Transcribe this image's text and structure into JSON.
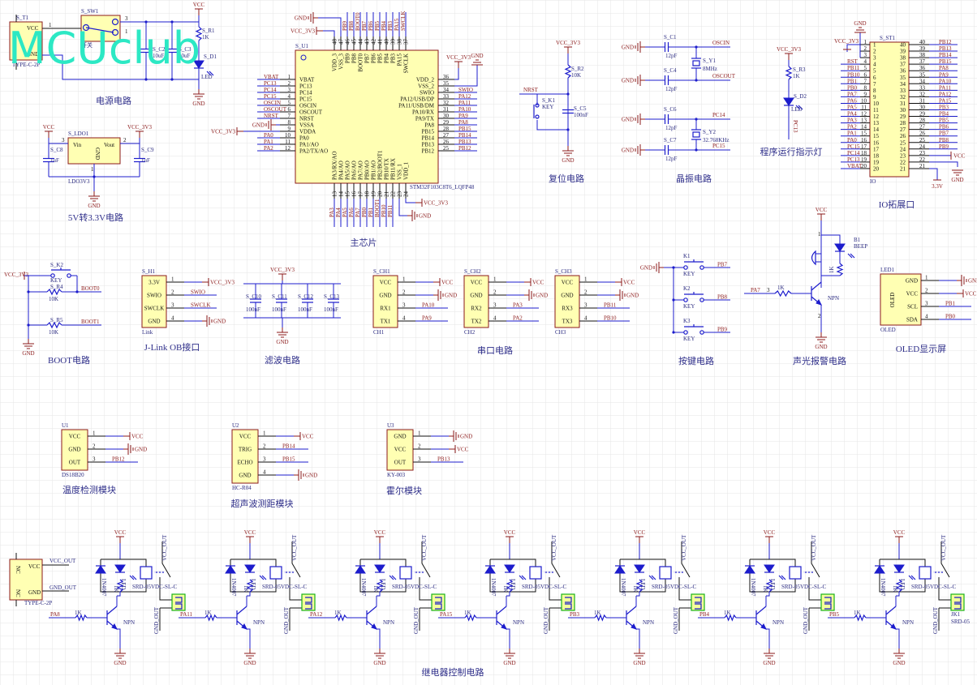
{
  "watermark": "MCUclub",
  "colors": {
    "wire": "#1c1ccc",
    "net_label": "#8b1a1a",
    "component_fill": "#ffffb3",
    "component_border": "#8b1a1a",
    "title": "#2f2f8a",
    "watermark": "#2ce8c4",
    "relay_connector": "#19b019"
  },
  "nets": {
    "vcc": "VCC",
    "gnd": "GND",
    "v33": "VCC_3V3"
  },
  "titles": {
    "power": "电源电路",
    "ldo": "5V转3.3V电路",
    "mcu": "主芯片",
    "reset": "复位电路",
    "crystal": "晶振电路",
    "led": "程序运行指示灯",
    "io": "IO拓展口",
    "boot": "BOOT电路",
    "jlink": "J-Link OB接口",
    "filter": "滤波电路",
    "uart": "串口电路",
    "keys": "按键电路",
    "alarm": "声光报警电路",
    "oled": "OLED显示屏",
    "temp": "温度检测模块",
    "ultra": "超声波测距模块",
    "hall": "霍尔模块",
    "relay": "继电器控制电路"
  },
  "power": {
    "t1_ref": "S_T1",
    "t1_part": "TYPE-C-2P",
    "t1_vcc": "VCC",
    "t1_gnd": "GND",
    "sw_ref": "S_SW1",
    "sw_name": "开关",
    "pin1": "1",
    "pin2": "2",
    "pin3": "3",
    "c2": "S_C2",
    "c3": "S_C3",
    "c_val": "10uF",
    "r1": "S_R1",
    "r1_val": "1K",
    "d1": "S_D1",
    "d1_val": "LED"
  },
  "ldo": {
    "ref": "S_LDO1",
    "part": "LDO3V3",
    "vin": "Vin",
    "vout": "Vout",
    "gnd": "GND",
    "c8": "S_C8",
    "c9": "S_C9",
    "c_val": "1uF",
    "p1": "1",
    "p2": "2",
    "p3": "3"
  },
  "mcu": {
    "ref": "S_U1",
    "part": "STM32F103C8T6_LQFP48",
    "left": [
      [
        "1",
        "VBAT",
        "VBAT"
      ],
      [
        "2",
        "PC13",
        "PC13"
      ],
      [
        "3",
        "PC14",
        "PC14"
      ],
      [
        "4",
        "PC15",
        "PC15"
      ],
      [
        "5",
        "OSCIN",
        "OSCIN"
      ],
      [
        "6",
        "OSCOUT",
        "OSCOUT"
      ],
      [
        "7",
        "NRST",
        "NRST"
      ],
      [
        "8",
        "VSSA",
        "GND"
      ],
      [
        "9",
        "VDDA",
        "VCC_3V3"
      ],
      [
        "10",
        "PA0",
        "PA0"
      ],
      [
        "11",
        "PA1/AO",
        "PA1"
      ],
      [
        "12",
        "PA2/TX/AO",
        "PA2"
      ]
    ],
    "right": [
      [
        "36",
        "VDD_2",
        "VCC_3V3"
      ],
      [
        "35",
        "VSS_2",
        "GND"
      ],
      [
        "34",
        "SWIO",
        "SWIO"
      ],
      [
        "33",
        "PA12/USB/DP",
        "PA12"
      ],
      [
        "32",
        "PA11/USB/DM",
        "PA11"
      ],
      [
        "31",
        "PA10/RX",
        "PA10"
      ],
      [
        "30",
        "PA9/TX",
        "PA9"
      ],
      [
        "29",
        "PA8",
        "PA8"
      ],
      [
        "28",
        "PB15",
        "PB15"
      ],
      [
        "27",
        "PB14",
        "PB14"
      ],
      [
        "26",
        "PB13",
        "PB13"
      ],
      [
        "25",
        "PB12",
        "PB12"
      ]
    ],
    "top": [
      [
        "48",
        "VDD_3",
        "VCC_3V3"
      ],
      [
        "47",
        "VSS_3",
        "GND"
      ],
      [
        "46",
        "PB9",
        "PB9"
      ],
      [
        "45",
        "PB8",
        "PB8"
      ],
      [
        "44",
        "BOOT0",
        "BOOT0"
      ],
      [
        "43",
        "PB7",
        "PB7"
      ],
      [
        "42",
        "PB6",
        "PB6"
      ],
      [
        "41",
        "PB5",
        "PB5"
      ],
      [
        "40",
        "PB4",
        "PB4"
      ],
      [
        "39",
        "PB3",
        "PB3"
      ],
      [
        "38",
        "PA15",
        "PA15"
      ],
      [
        "37",
        "SWCLK",
        "SWCLK"
      ]
    ],
    "bottom": [
      [
        "13",
        "PA3/RX/AO",
        "PA3"
      ],
      [
        "14",
        "PA4/AO",
        "PA4"
      ],
      [
        "15",
        "PA5/AO",
        "PA5"
      ],
      [
        "16",
        "PA6/AO",
        "PA6"
      ],
      [
        "17",
        "PA7/AO",
        "PA7"
      ],
      [
        "18",
        "PB0/AO",
        "PB0"
      ],
      [
        "19",
        "PB1/AO",
        "PB1"
      ],
      [
        "20",
        "PB2/BOOT1",
        "BOOT1"
      ],
      [
        "21",
        "PB10/TX",
        "PB10"
      ],
      [
        "22",
        "PB11/RX",
        "PB11"
      ],
      [
        "23",
        "VSS_1",
        "GND"
      ],
      [
        "24",
        "VDD_1",
        "VCC_3V3"
      ]
    ]
  },
  "reset": {
    "r2": "S_R2",
    "r2_val": "10K",
    "k1": "S_K1",
    "k1_val": "KEY",
    "c5": "S_C5",
    "c5_val": "100nF",
    "nrst": "NRST"
  },
  "crystal": {
    "c1": "S_C1",
    "c4": "S_C4",
    "c6": "S_C6",
    "c7": "S_C7",
    "c_val": "12pF",
    "y1": "S_Y1",
    "y1_val": "8MHz",
    "y2": "S_Y2",
    "y2_val": "32.768KHz",
    "oscin": "OSCIN",
    "oscout": "OSCOUT",
    "pc14": "PC14",
    "pc15": "PC15"
  },
  "runled": {
    "r3": "S_R3",
    "r3_val": "1K",
    "d2": "S_D2",
    "d2_val": "LED",
    "net": "PC13"
  },
  "io": {
    "ref": "S_ST1",
    "part": "IO",
    "left": [
      [
        "1",
        "VCC_3V3"
      ],
      [
        "2",
        ""
      ],
      [
        "3",
        ""
      ],
      [
        "4",
        "RST"
      ],
      [
        "5",
        "PB11"
      ],
      [
        "6",
        "PB10"
      ],
      [
        "7",
        "PB1"
      ],
      [
        "8",
        "PB0"
      ],
      [
        "9",
        "PA7"
      ],
      [
        "10",
        "PA6"
      ],
      [
        "11",
        "PA5"
      ],
      [
        "12",
        "PA4"
      ],
      [
        "13",
        "PA3"
      ],
      [
        "14",
        "PA2"
      ],
      [
        "15",
        "PA1"
      ],
      [
        "16",
        "PA0"
      ],
      [
        "17",
        "PC15"
      ],
      [
        "18",
        "PC14"
      ],
      [
        "19",
        "PC13"
      ],
      [
        "20",
        "VBAT"
      ]
    ],
    "right": [
      [
        "40",
        "PB12"
      ],
      [
        "39",
        "PB13"
      ],
      [
        "38",
        "PB14"
      ],
      [
        "37",
        "PB15"
      ],
      [
        "36",
        "PA8"
      ],
      [
        "35",
        "PA9"
      ],
      [
        "34",
        "PA10"
      ],
      [
        "33",
        "PA11"
      ],
      [
        "32",
        "PA12"
      ],
      [
        "31",
        "PA15"
      ],
      [
        "30",
        "PB3"
      ],
      [
        "29",
        "PB4"
      ],
      [
        "28",
        "PB5"
      ],
      [
        "27",
        "PB6"
      ],
      [
        "26",
        "PB7"
      ],
      [
        "25",
        "PB8"
      ],
      [
        "24",
        "PB9"
      ],
      [
        "23",
        "VCC"
      ],
      [
        "22",
        "GND"
      ],
      [
        "21",
        "3.3V"
      ]
    ]
  },
  "boot": {
    "k2": "S_K2",
    "k2_val": "KEY",
    "r4": "S_R4",
    "r5": "S_R5",
    "r_val": "10K",
    "boot0": "BOOT0",
    "boot1": "BOOT1"
  },
  "jlink": {
    "ref": "S_H1",
    "part": "Link",
    "pins": [
      [
        "1",
        "3.3V",
        "VCC_3V3"
      ],
      [
        "2",
        "SWIO",
        "SWIO"
      ],
      [
        "3",
        "SWCLK",
        "SWCLK"
      ],
      [
        "4",
        "GND",
        "GND"
      ]
    ]
  },
  "filter": {
    "caps": [
      "S_C10",
      "S_C11",
      "S_C12",
      "S_C13"
    ],
    "c_val": "100nF"
  },
  "uart": [
    {
      "ref": "S_CH1",
      "part": "CH1",
      "pins": [
        [
          "1",
          "VCC",
          "VCC"
        ],
        [
          "2",
          "GND",
          "GND"
        ],
        [
          "3",
          "RX1",
          "PA10"
        ],
        [
          "4",
          "TX1",
          "PA9"
        ]
      ]
    },
    {
      "ref": "S_CH2",
      "part": "CH2",
      "pins": [
        [
          "1",
          "VCC",
          "VCC"
        ],
        [
          "2",
          "GND",
          "GND"
        ],
        [
          "3",
          "RX2",
          "PA3"
        ],
        [
          "4",
          "TX2",
          "PA2"
        ]
      ]
    },
    {
      "ref": "S_CH3",
      "part": "CH3",
      "pins": [
        [
          "1",
          "VCC",
          "VCC"
        ],
        [
          "2",
          "GND",
          "GND"
        ],
        [
          "3",
          "RX3",
          "PB11"
        ],
        [
          "4",
          "TX3",
          "PB10"
        ]
      ]
    }
  ],
  "keys": [
    {
      "ref": "K1",
      "val": "KEY",
      "net": "PB7"
    },
    {
      "ref": "K2",
      "val": "KEY",
      "net": "PB8"
    },
    {
      "ref": "K3",
      "val": "KEY",
      "net": "PB9"
    }
  ],
  "alarm": {
    "ref": "B1",
    "val": "BEEP",
    "r_val": "1K",
    "input": "PA7",
    "pin3": "3",
    "pin1": "1",
    "pin2": "2",
    "npn": "NPN"
  },
  "oled": {
    "ref": "LED1",
    "part": "OLED",
    "center": "OLED",
    "pins": [
      [
        "1",
        "GND",
        "GND"
      ],
      [
        "2",
        "VCC",
        "VCC"
      ],
      [
        "3",
        "SCL",
        "PB1"
      ],
      [
        "4",
        "SDA",
        "PB0"
      ]
    ]
  },
  "modules": [
    {
      "ref": "U1",
      "part": "DS18B20",
      "pins": [
        [
          "1",
          "VCC",
          "VCC"
        ],
        [
          "2",
          "GND",
          "GND"
        ],
        [
          "3",
          "OUT",
          "PB12"
        ]
      ]
    },
    {
      "ref": "U2",
      "part": "HC-R04",
      "pins": [
        [
          "1",
          "VCC",
          "VCC"
        ],
        [
          "2",
          "TRIG",
          "PB14"
        ],
        [
          "3",
          "ECHO",
          "PB15"
        ],
        [
          "4",
          "GND",
          "GND"
        ]
      ]
    },
    {
      "ref": "U3",
      "part": "KY-003",
      "pins": [
        [
          "1",
          "GND",
          "GND"
        ],
        [
          "2",
          "VCC",
          "VCC"
        ],
        [
          "3",
          "OUT",
          "PB13"
        ]
      ]
    }
  ],
  "relay": {
    "conn_part": "TYPE-C-2P",
    "nc": "NC",
    "vcc_pin": "VCC",
    "gnd_pin": "GND",
    "vcc_out": "VCC_OUT",
    "gnd_out": "GND_OUT",
    "diode": "1N4007",
    "led": "LED",
    "r_val": "1K",
    "npn": "NPN",
    "relay_part": "SRD-05VDC-SL-C",
    "inputs": [
      "PA8",
      "PA11",
      "PA12",
      "PA15",
      "PB3",
      "PB4",
      "PB5"
    ],
    "jk_ref": "JK1",
    "jk_part": "SRD-05"
  }
}
